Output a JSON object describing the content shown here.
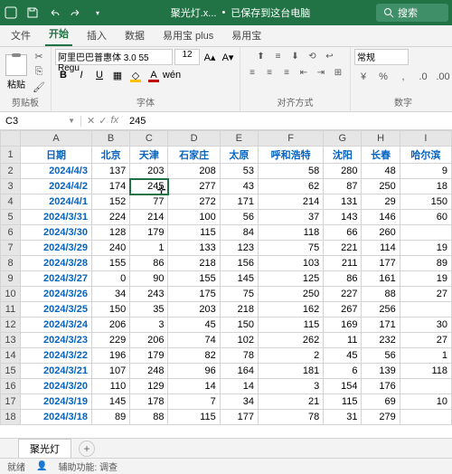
{
  "titlebar": {
    "filename": "聚光灯.x...",
    "saved_status": "已保存到这台电脑",
    "search_placeholder": "搜索"
  },
  "tabs": {
    "file": "文件",
    "home": "开始",
    "insert": "插入",
    "data": "数据",
    "yiyongbao_plus": "易用宝 plus",
    "yiyongbao": "易用宝"
  },
  "ribbon": {
    "clipboard": {
      "label": "剪贴板",
      "paste": "粘贴"
    },
    "font": {
      "label": "字体",
      "name": "阿里巴巴普惠体 3.0 55 Regu",
      "size": "12"
    },
    "align": {
      "label": "对齐方式"
    },
    "number": {
      "label": "数字",
      "format": "常规"
    }
  },
  "namebox": "C3",
  "formula": "245",
  "columns": [
    "A",
    "B",
    "C",
    "D",
    "E",
    "F",
    "G",
    "H",
    "I"
  ],
  "headers": [
    "日期",
    "北京",
    "天津",
    "石家庄",
    "太原",
    "呼和浩特",
    "沈阳",
    "长春",
    "哈尔滨"
  ],
  "rows": [
    {
      "r": 2,
      "d": "2024/4/3",
      "v": [
        137,
        203,
        208,
        53,
        58,
        280,
        48,
        "9"
      ]
    },
    {
      "r": 3,
      "d": "2024/4/2",
      "v": [
        174,
        "245",
        277,
        43,
        62,
        87,
        250,
        "18"
      ]
    },
    {
      "r": 4,
      "d": "2024/4/1",
      "v": [
        152,
        77,
        272,
        171,
        214,
        131,
        29,
        "150"
      ]
    },
    {
      "r": 5,
      "d": "2024/3/31",
      "v": [
        224,
        214,
        100,
        56,
        37,
        143,
        146,
        "60"
      ]
    },
    {
      "r": 6,
      "d": "2024/3/30",
      "v": [
        128,
        179,
        115,
        84,
        118,
        66,
        260,
        ""
      ]
    },
    {
      "r": 7,
      "d": "2024/3/29",
      "v": [
        240,
        1,
        133,
        123,
        75,
        221,
        114,
        "19"
      ]
    },
    {
      "r": 8,
      "d": "2024/3/28",
      "v": [
        155,
        86,
        218,
        156,
        103,
        211,
        177,
        "89"
      ]
    },
    {
      "r": 9,
      "d": "2024/3/27",
      "v": [
        0,
        90,
        155,
        145,
        125,
        86,
        161,
        "19"
      ]
    },
    {
      "r": 10,
      "d": "2024/3/26",
      "v": [
        34,
        243,
        175,
        75,
        250,
        227,
        88,
        "27"
      ]
    },
    {
      "r": 11,
      "d": "2024/3/25",
      "v": [
        150,
        35,
        203,
        218,
        162,
        267,
        256,
        ""
      ]
    },
    {
      "r": 12,
      "d": "2024/3/24",
      "v": [
        206,
        3,
        45,
        150,
        115,
        169,
        171,
        "30"
      ]
    },
    {
      "r": 13,
      "d": "2024/3/23",
      "v": [
        229,
        206,
        74,
        102,
        262,
        11,
        232,
        "27"
      ]
    },
    {
      "r": 14,
      "d": "2024/3/22",
      "v": [
        196,
        179,
        82,
        78,
        2,
        45,
        56,
        "1"
      ]
    },
    {
      "r": 15,
      "d": "2024/3/21",
      "v": [
        107,
        248,
        96,
        164,
        181,
        6,
        139,
        "118"
      ]
    },
    {
      "r": 16,
      "d": "2024/3/20",
      "v": [
        110,
        129,
        14,
        14,
        3,
        154,
        176,
        ""
      ]
    },
    {
      "r": 17,
      "d": "2024/3/19",
      "v": [
        145,
        178,
        7,
        34,
        21,
        115,
        69,
        "10"
      ]
    },
    {
      "r": 18,
      "d": "2024/3/18",
      "v": [
        89,
        88,
        115,
        177,
        78,
        31,
        279,
        ""
      ]
    }
  ],
  "sheet_tab": "聚光灯",
  "status": {
    "ready": "就绪",
    "acc": "辅助功能: 调查"
  }
}
